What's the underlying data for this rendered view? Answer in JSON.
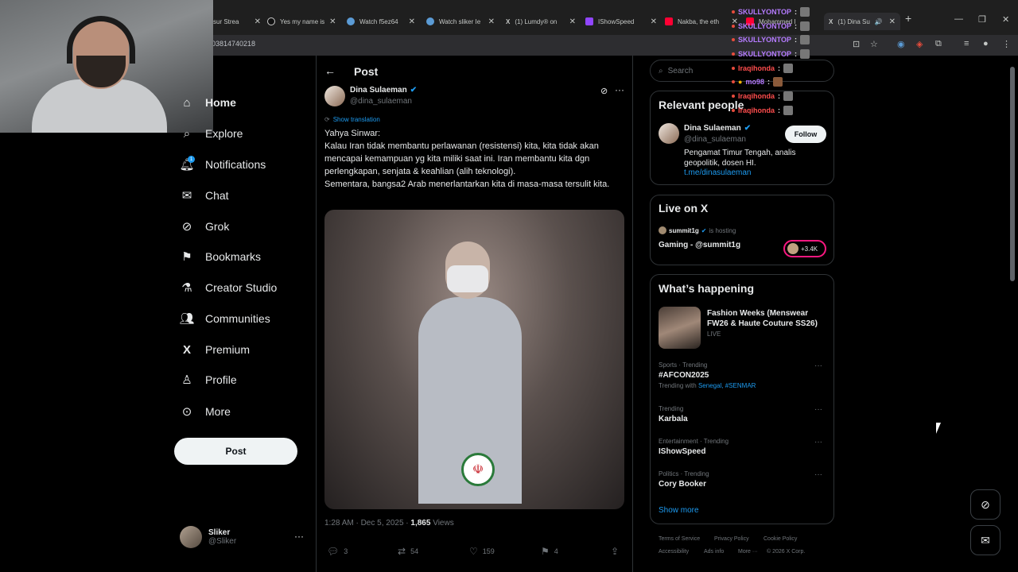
{
  "browser": {
    "tabs": [
      {
        "label": "sur Strea",
        "icon": "twitch-icon"
      },
      {
        "label": "Yes my name is",
        "icon": "tiktok-icon"
      },
      {
        "label": "Watch f5ez64",
        "icon": "kick-icon"
      },
      {
        "label": "Watch sliker Ie",
        "icon": "kick-icon"
      },
      {
        "label": "(1) Lumdy® on",
        "icon": "x-icon"
      },
      {
        "label": "IShowSpeed",
        "icon": "twitch-icon"
      },
      {
        "label": "Nakba, the eth",
        "icon": "youtube-icon"
      },
      {
        "label": "Mohammed I",
        "icon": "youtube-icon"
      },
      {
        "label": "(1) Dina Su",
        "icon": "x-icon"
      }
    ],
    "url": "03814740218"
  },
  "nav": {
    "items": [
      {
        "label": "Home",
        "icon": "home-icon"
      },
      {
        "label": "Explore",
        "icon": "search-icon"
      },
      {
        "label": "Notifications",
        "icon": "bell-icon"
      },
      {
        "label": "Chat",
        "icon": "mail-icon"
      },
      {
        "label": "Grok",
        "icon": "grok-icon"
      },
      {
        "label": "Bookmarks",
        "icon": "bookmark-icon"
      },
      {
        "label": "Creator Studio",
        "icon": "flask-icon"
      },
      {
        "label": "Communities",
        "icon": "people-icon"
      },
      {
        "label": "Premium",
        "icon": "x-logo-icon"
      },
      {
        "label": "Profile",
        "icon": "person-icon"
      },
      {
        "label": "More",
        "icon": "more-circle-icon"
      }
    ],
    "notification_badge": "1",
    "post_button": "Post",
    "account": {
      "name": "Sliker",
      "handle": "@Sliker"
    }
  },
  "post": {
    "header": "Post",
    "author": {
      "name": "Dina Sulaeman",
      "handle": "@dina_sulaeman"
    },
    "show_translation": "Show translation",
    "text": "Yahya Sinwar:\nKalau Iran tidak membantu perlawanan (resistensi) kita, kita tidak akan mencapai kemampuan yg kita miliki saat ini. Iran membantu kita dgn perlengkapan, senjata & keahlian (alih teknologi).\nSementara, bangsa2 Arab menerlantarkan kita di masa-masa tersulit kita.",
    "timestamp": "1:28 AM · Dec 5, 2025",
    "views_count": "1,865",
    "views_label": "Views",
    "actions": {
      "replies": "3",
      "reposts": "54",
      "likes": "159",
      "bookmarks": "4"
    }
  },
  "sidebar": {
    "search_placeholder": "Search",
    "relevant": {
      "title": "Relevant people",
      "name": "Dina Sulaeman",
      "handle": "@dina_sulaeman",
      "follow": "Follow",
      "bio": "Pengamat Timur Tengah, analis geopolitik, dosen HI.",
      "link": "t.me/dinasulaeman"
    },
    "live": {
      "title": "Live on X",
      "host": "summit1g",
      "hosting": "is hosting",
      "space": "Gaming - @summit1g",
      "listeners": "+3.4K"
    },
    "happening": {
      "title": "What’s happening",
      "featured": {
        "title": "Fashion Weeks (Menswear FW26 & Haute Couture SS26)",
        "status": "LIVE"
      },
      "trends": [
        {
          "context": "Sports · Trending",
          "name": "#AFCON2025",
          "with_label": "Trending with",
          "with": "Senegal, #SENMAR"
        },
        {
          "context": "Trending",
          "name": "Karbala"
        },
        {
          "context": "Entertainment · Trending",
          "name": "IShowSpeed"
        },
        {
          "context": "Politics · Trending",
          "name": "Cory Booker"
        }
      ],
      "show_more": "Show more"
    },
    "footer": [
      "Terms of Service",
      "Privacy Policy",
      "Cookie Policy",
      "Accessibility",
      "Ads info",
      "More ···",
      "© 2026 X Corp."
    ]
  },
  "chat_overlay": [
    {
      "user": "SKULLYONTOP",
      "text": ":",
      "color": "#b57bff"
    },
    {
      "user": "SKULLYONTOP",
      "text": ":",
      "color": "#b57bff"
    },
    {
      "user": "SKULLYONTOP",
      "text": ":",
      "color": "#b57bff"
    },
    {
      "user": "SKULLYONTOP",
      "text": ":",
      "color": "#b57bff"
    },
    {
      "user": "Iraqihonda",
      "text": ":",
      "color": "#ff4d4d"
    },
    {
      "user": "mo98",
      "text": ":",
      "color": "#b57bff"
    },
    {
      "user": "Iraqihonda",
      "text": ":",
      "color": "#ff4d4d"
    },
    {
      "user": "Iraqihonda",
      "text": ":",
      "color": "#ff4d4d"
    }
  ],
  "colors": {
    "accent": "#1d9bf0",
    "background": "#000000",
    "text": "#e7e9ea",
    "muted": "#71767b",
    "verified": "#1d9bf0"
  }
}
